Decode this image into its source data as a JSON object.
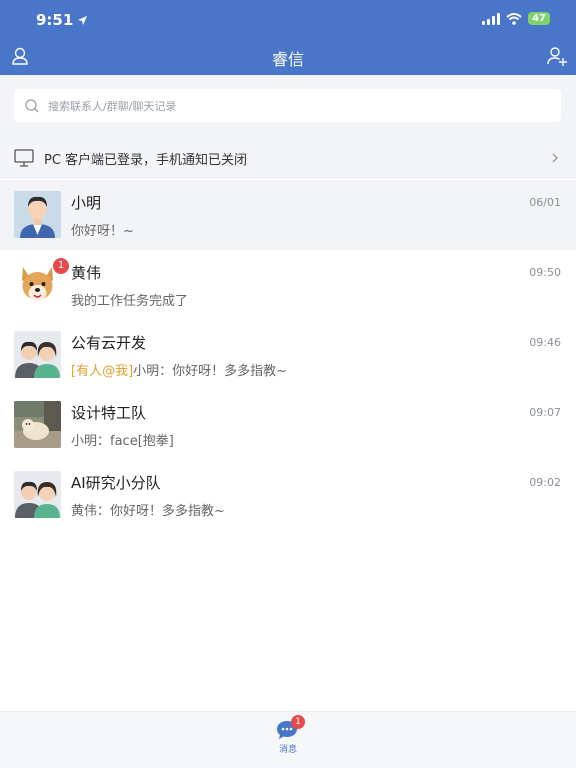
{
  "status_bar": {
    "time": "9:51",
    "battery": "47"
  },
  "nav": {
    "title": "睿信"
  },
  "search": {
    "placeholder": "搜索联系人/群聊/聊天记录"
  },
  "pc_banner": {
    "text": "PC 客户端已登录，手机通知已关闭"
  },
  "conversations": [
    {
      "name": "小明",
      "time": "06/01",
      "preview": "你好呀！~",
      "badge": "",
      "mention": "",
      "avatar": "man-portrait"
    },
    {
      "name": "黄伟",
      "time": "09:50",
      "preview": "我的工作任务完成了",
      "badge": "1",
      "mention": "",
      "avatar": "dog-photo"
    },
    {
      "name": "公有云开发",
      "time": "09:46",
      "preview": "小明：你好呀！多多指教~",
      "badge": "",
      "mention": "[有人@我]",
      "avatar": "group-avatar"
    },
    {
      "name": "设计特工队",
      "time": "09:07",
      "preview": "小明：face[抱拳]",
      "badge": "",
      "mention": "",
      "avatar": "photo-avatar"
    },
    {
      "name": "AI研究小分队",
      "time": "09:02",
      "preview": "黄伟：你好呀！多多指教~",
      "badge": "",
      "mention": "",
      "avatar": "group-avatar"
    }
  ],
  "tabbar": {
    "label": "消息",
    "badge": "1"
  },
  "colors": {
    "header": "#4a76c9",
    "badge": "#e54b4b",
    "mention": "#e0a030",
    "battery": "#7fd36c"
  }
}
